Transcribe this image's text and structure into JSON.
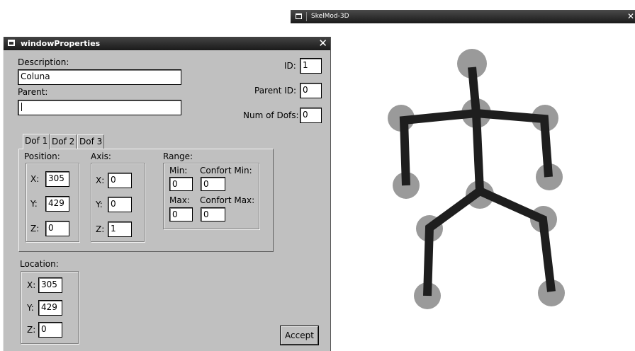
{
  "properties_window": {
    "title": "windowProperties",
    "description_label": "Description:",
    "description_value": "Coluna",
    "parent_label": "Parent:",
    "parent_value": "",
    "id_label": "ID:",
    "id_value": "1",
    "parent_id_label": "Parent ID:",
    "parent_id_value": "0",
    "num_dofs_label": "Num of Dofs:",
    "num_dofs_value": "0",
    "tabs": [
      "Dof 1",
      "Dof 2",
      "Dof 3"
    ],
    "active_tab": "Dof 1",
    "position": {
      "label": "Position:",
      "x_label": "X:",
      "x": "305",
      "y_label": "Y:",
      "y": "429",
      "z_label": "Z:",
      "z": "0"
    },
    "axis": {
      "label": "Axis:",
      "x_label": "X:",
      "x": "0",
      "y_label": "Y:",
      "y": "0",
      "z_label": "Z:",
      "z": "1"
    },
    "range": {
      "label": "Range:",
      "min_label": "Min:",
      "min": "0",
      "confort_min_label": "Confort Min:",
      "confort_min": "0",
      "max_label": "Max:",
      "max": "0",
      "confort_max_label": "Confort Max:",
      "confort_max": "0"
    },
    "location": {
      "label": "Location:",
      "x_label": "X:",
      "x": "305",
      "y_label": "Y:",
      "y": "429",
      "z_label": "Z:",
      "z": "0"
    },
    "accept_label": "Accept",
    "close_icon": "close-icon",
    "window_menu_icon": "window-menu-icon"
  },
  "skelmod_window": {
    "title": "SkelMod-3D",
    "close_icon": "close-icon",
    "window_menu_icon": "window-menu-icon",
    "colors": {
      "bone": "#1e1e1e",
      "joint": "#9a9a9a",
      "background": "#ffffff"
    }
  }
}
